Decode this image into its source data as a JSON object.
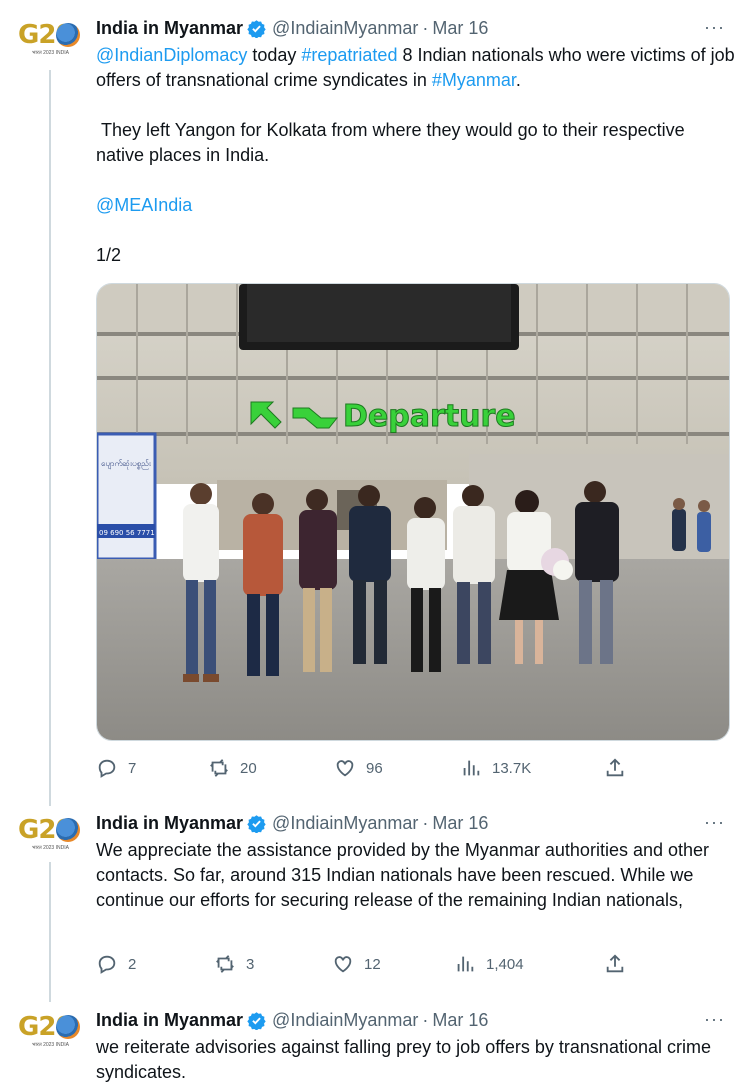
{
  "tweets": [
    {
      "author": {
        "name": "India in Myanmar",
        "handle": "@IndiainMyanmar",
        "date": "Mar 16",
        "avatar_text": "G20",
        "avatar_sub": "भारत 2023 INDIA"
      },
      "text": {
        "p1_link1": "@IndianDiplomacy",
        "p1_t1": " today ",
        "p1_link2": "#repatriated",
        "p1_t2": " 8 Indian nationals who were victims of job offers of transnational crime syndicates in ",
        "p1_link3": "#Myanmar",
        "p1_t3": ".",
        "p2": " They left Yangon for Kolkata from where they would go to their respective native places in India.",
        "p3_link": "@MEAIndia",
        "p4": "1/2"
      },
      "media": {
        "sign_text": "Departure",
        "screen_text": "ပျောက်ဆုံးပစ္စည်း",
        "phone_text": "09 690 56 7771"
      },
      "stats": {
        "replies": "7",
        "reposts": "20",
        "likes": "96",
        "views": "13.7K"
      }
    },
    {
      "author": {
        "name": "India in Myanmar",
        "handle": "@IndiainMyanmar",
        "date": "Mar 16",
        "avatar_text": "G20",
        "avatar_sub": "भारत 2023 INDIA"
      },
      "text": {
        "body": "We appreciate the assistance provided by the Myanmar authorities and other contacts. So far, around 315 Indian nationals have been rescued. While we continue our efforts for securing release of the remaining Indian nationals,"
      },
      "stats": {
        "replies": "2",
        "reposts": "3",
        "likes": "12",
        "views": "1,404"
      }
    },
    {
      "author": {
        "name": "India in Myanmar",
        "handle": "@IndiainMyanmar",
        "date": "Mar 16",
        "avatar_text": "G20",
        "avatar_sub": "भारत 2023 INDIA"
      },
      "text": {
        "body": "we reiterate advisories against falling prey to job offers by transnational crime syndicates."
      }
    }
  ],
  "more_label": "···",
  "colors": {
    "link": "#1d9bf0",
    "secondary": "#536471",
    "verified": "#1d9bf0"
  }
}
